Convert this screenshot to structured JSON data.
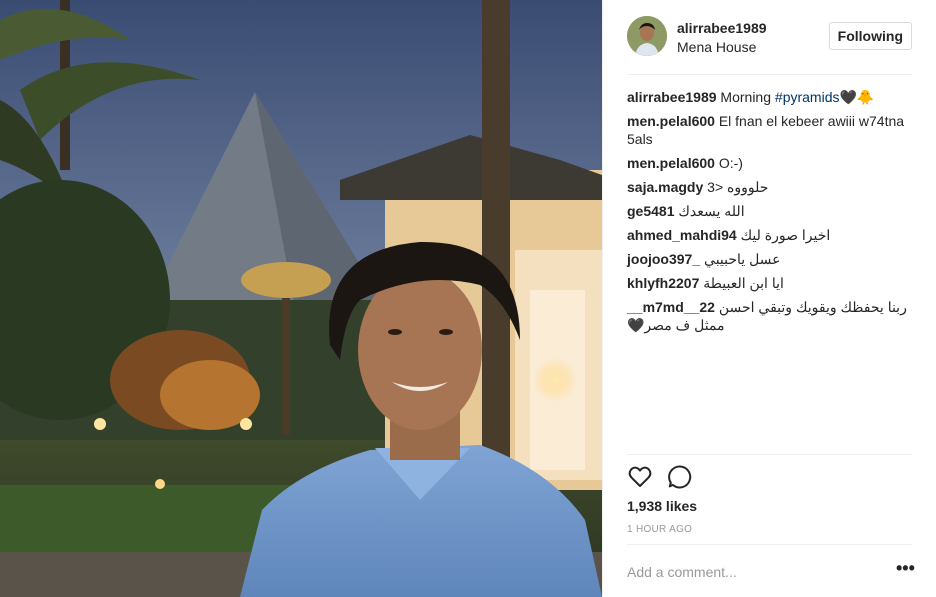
{
  "post": {
    "author": "alirrabee1989",
    "location": "Mena House",
    "follow_label": "Following",
    "likes": "1,938 likes",
    "time": "1 HOUR AGO",
    "comment_placeholder": "Add a comment...",
    "more_label": "•••"
  },
  "caption": {
    "user": "alirrabee1989",
    "text": "Morning",
    "hashtag": "#pyramids",
    "emoji": "🖤🐥"
  },
  "comments": [
    {
      "user": "men.pelal600",
      "text": "El fnan el kebeer awiii w74tna 5als"
    },
    {
      "user": "men.pelal600",
      "text": "O:-)"
    },
    {
      "user": "saja.magdy",
      "text": "حلوووه <3"
    },
    {
      "user": "ge5481",
      "text": "الله يسعدك"
    },
    {
      "user": "ahmed_mahdi94",
      "text": "اخيرا صورة ليك"
    },
    {
      "user": "joojoo397_",
      "text": "عسل ياحبيبي"
    },
    {
      "user": "khlyfh2207",
      "text": "ايا ابن العبيطة"
    },
    {
      "user": "__m7md__22",
      "text": "ربنا يحفظك ويقويك وتبقي احسن ممثل ف مصر🖤"
    }
  ],
  "icons": {
    "like": "heart-outline-icon",
    "comment": "speech-bubble-icon"
  }
}
